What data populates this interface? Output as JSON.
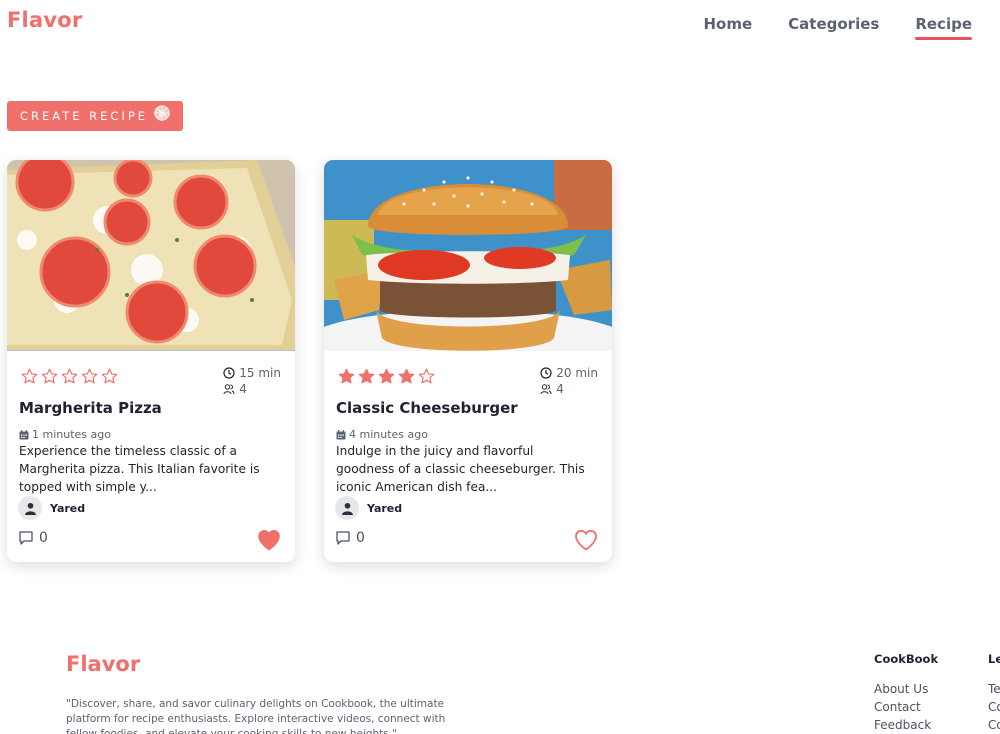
{
  "header": {
    "logo": "Flavor",
    "nav": [
      {
        "label": "Home"
      },
      {
        "label": "Categories"
      },
      {
        "label": "Recipe",
        "active": true
      }
    ]
  },
  "create_button": {
    "label": "CREATE RECIPE"
  },
  "recipes": [
    {
      "title": "Margherita Pizza",
      "rating": 0,
      "max_rating": 5,
      "time": "15 min",
      "servings": "4",
      "posted": "1 minutes ago",
      "description": "Experience the timeless classic of a Margherita pizza. This Italian favorite is topped with simple y...",
      "author": "Yared",
      "comments": "0",
      "liked": true,
      "image": "pizza-photo"
    },
    {
      "title": "Classic Cheeseburger",
      "rating": 4,
      "max_rating": 5,
      "time": "20 min",
      "servings": "4",
      "posted": "4 minutes ago",
      "description": "Indulge in the juicy and flavorful goodness of a classic cheeseburger. This iconic American dish fea...",
      "author": "Yared",
      "comments": "0",
      "liked": false,
      "image": "burger-photo"
    }
  ],
  "footer": {
    "logo": "Flavor",
    "tagline": "\"Discover, share, and savor culinary delights on Cookbook, the ultimate platform for recipe enthusiasts. Explore interactive videos, connect with fellow foodies, and elevate your cooking skills to new heights.\"",
    "columns": [
      {
        "title": "CookBook",
        "links": [
          "About Us",
          "Contact",
          "Feedback"
        ]
      },
      {
        "title": "Le",
        "links": [
          "Te",
          "Co",
          "Co"
        ]
      }
    ]
  },
  "colors": {
    "accent": "#f0706b",
    "nav_text": "#5b6272",
    "active_underline": "#e8525a",
    "star": "#f0706b"
  }
}
